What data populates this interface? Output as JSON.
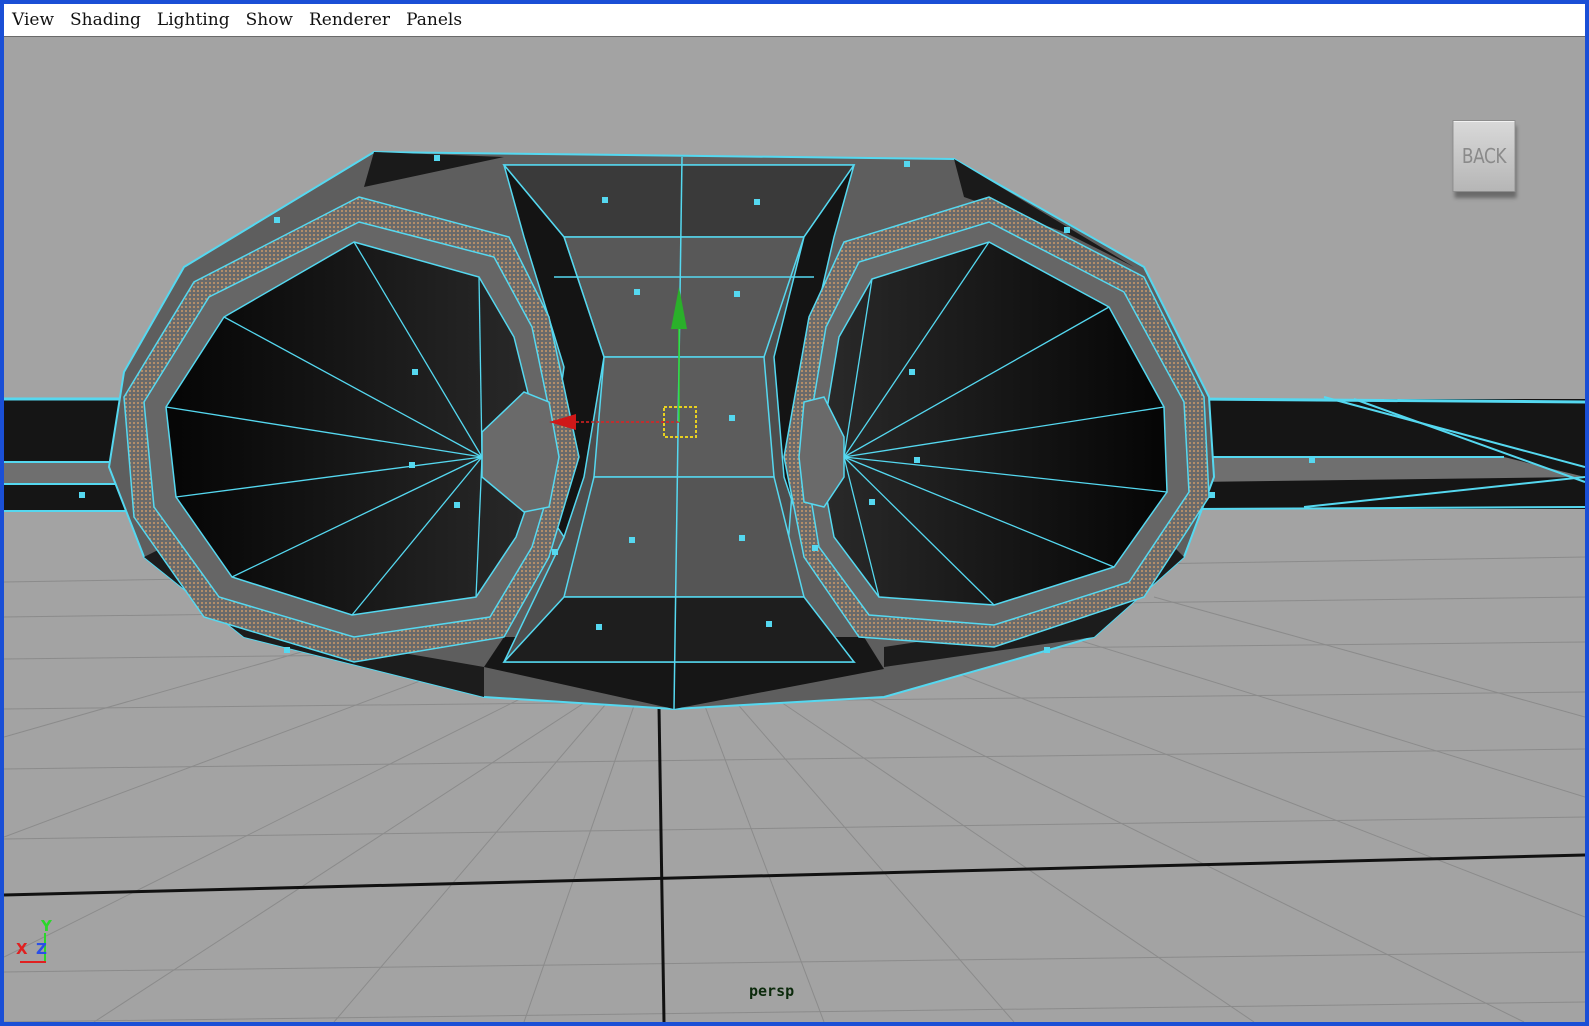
{
  "menubar": {
    "items": [
      {
        "label": "View"
      },
      {
        "label": "Shading"
      },
      {
        "label": "Lighting"
      },
      {
        "label": "Show"
      },
      {
        "label": "Renderer"
      },
      {
        "label": "Panels"
      }
    ]
  },
  "viewport": {
    "back_button_label": "BACK",
    "camera_name": "persp",
    "axis_gizmo": {
      "x": "X",
      "y": "Y",
      "z": "Z"
    }
  },
  "colors": {
    "frame_border": "#1a4fd6",
    "viewport_bg": "#a3a3a3",
    "wireframe_highlight": "#55d8f0",
    "mesh_dark": "#111111",
    "mesh_gray": "#6d6d6d",
    "grid_line": "#8a8a8a",
    "grid_axis": "#111111"
  },
  "icons": [
    "move-manipulator-icon",
    "axis-gizmo-icon"
  ]
}
